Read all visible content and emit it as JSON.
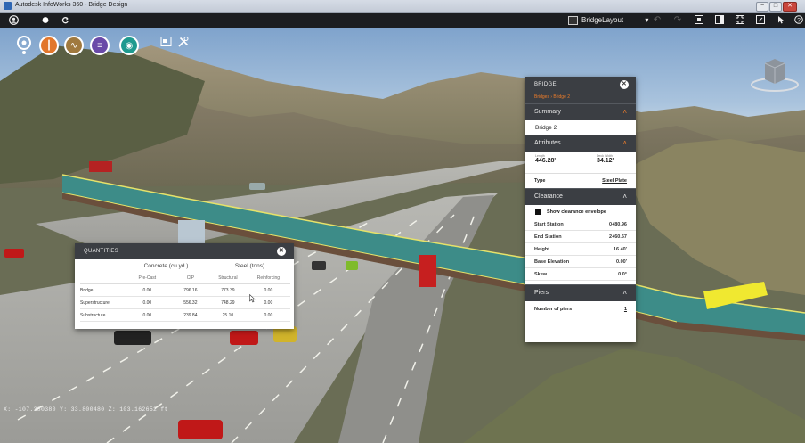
{
  "window": {
    "title": "Autodesk InfoWorks 360 - Bridge Design",
    "min_label": "−",
    "max_label": "□",
    "close_label": "✕"
  },
  "toolbar": {
    "layout_label": "BridgeLayout",
    "layout_dropdown": "▾",
    "left_icons": [
      "user-icon",
      "dot-icon",
      "refresh-icon"
    ],
    "right_icons": [
      "undo-icon",
      "redo-icon",
      "grid-icon",
      "panel-icon",
      "fit-icon",
      "screenshot-icon",
      "pointer-icon",
      "help-icon"
    ]
  },
  "modes": {
    "buttons": [
      {
        "name": "road-mode-button",
        "color": "#e2772c",
        "glyph": "┃"
      },
      {
        "name": "terrain-mode-button",
        "color": "#a0793e",
        "glyph": "∿"
      },
      {
        "name": "bridge-mode-button",
        "color": "#6a4aa8",
        "glyph": "≡"
      },
      {
        "name": "drainage-mode-button",
        "color": "#1f9a8f",
        "glyph": "◉"
      }
    ]
  },
  "bridge_panel": {
    "title": "BRIDGE",
    "close": "✕",
    "breadcrumb": "Bridges › Bridge 2",
    "summary": {
      "label": "Summary",
      "chevron": "˄",
      "name": "Bridge 2"
    },
    "attributes": {
      "label": "Attributes",
      "chevron": "˄",
      "length_caption": "Length",
      "length_value": "446.28'",
      "deck_caption": "Deck Width",
      "deck_value": "34.12'",
      "type_key": "Type",
      "type_value": "Steel Plate"
    },
    "clearance": {
      "label": "Clearance",
      "chevron": "˄",
      "checkbox_label": "Show clearance envelope",
      "rows": [
        {
          "key": "Start Station",
          "value": "0+80.96"
        },
        {
          "key": "End Station",
          "value": "2+60.67"
        },
        {
          "key": "Height",
          "value": "16.40'"
        },
        {
          "key": "Base Elevation",
          "value": "0.00'"
        },
        {
          "key": "Skew",
          "value": "0.0°"
        }
      ]
    },
    "piers": {
      "label": "Piers",
      "chevron": "˄",
      "key": "Number of piers",
      "value": "1"
    }
  },
  "quantities_panel": {
    "title": "QUANTITIES",
    "close": "✕",
    "group_headers": [
      "Concrete (cu.yd.)",
      "Steel (tons)"
    ],
    "sub_headers": [
      "Pre-Cast",
      "CIP",
      "Structural",
      "Reinforcing"
    ],
    "rows": [
      {
        "label": "Bridge",
        "values": [
          "0.00",
          "796.16",
          "773.39",
          "0.00"
        ]
      },
      {
        "label": "Superstructure",
        "values": [
          "0.00",
          "556.32",
          "748.29",
          "0.00"
        ]
      },
      {
        "label": "Substructure",
        "values": [
          "0.00",
          "239.84",
          "25.10",
          "0.00"
        ]
      }
    ]
  },
  "status": {
    "coordinates": "X: -107.380380  Y: 33.800480  Z: 103.162652  ft"
  },
  "colors": {
    "accent": "#ef7d2a",
    "panel_dark": "#3b3e43",
    "deck_teal": "#3d8c88",
    "toolbar": "#1c1e21"
  }
}
